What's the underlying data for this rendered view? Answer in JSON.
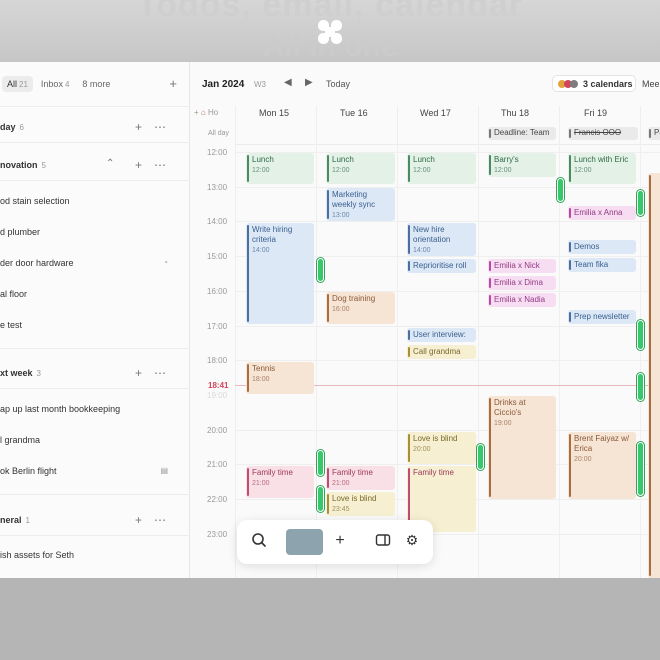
{
  "backdrop": {
    "headline_1": "Todos, email, calendar",
    "headline_2": "All in one"
  },
  "sidebar": {
    "tabs": [
      {
        "label": "All",
        "count": "21",
        "active": true
      },
      {
        "label": "Inbox",
        "count": "4",
        "active": false
      },
      {
        "label": "8 more",
        "count": "",
        "active": false
      }
    ],
    "sections": [
      {
        "title": "day",
        "count": "6"
      },
      {
        "title": "novation",
        "count": "5"
      },
      {
        "title": "xt week",
        "count": "3"
      },
      {
        "title": "neral",
        "count": "1"
      }
    ],
    "items": [
      {
        "label": "od stain selection",
        "icon": ""
      },
      {
        "label": "d plumber",
        "icon": ""
      },
      {
        "label": "der door hardware",
        "icon": "clock-icon"
      },
      {
        "label": "al floor",
        "icon": ""
      },
      {
        "label": "e test",
        "icon": ""
      },
      {
        "label": "ap up last month bookkeeping",
        "icon": ""
      },
      {
        "label": "l grandma",
        "icon": ""
      },
      {
        "label": "ok Berlin flight",
        "icon": "document-icon"
      },
      {
        "label": "ish assets for Seth",
        "icon": ""
      }
    ]
  },
  "calendar": {
    "month": "Jan 2024",
    "week": "W3",
    "today_label": "Today",
    "calendars_label": "3 calendars",
    "meet_label": "Mee",
    "timezone_label": "Ho",
    "allday_label": "All day",
    "days": [
      "Mon 15",
      "Tue 16",
      "Wed 17",
      "Thu 18",
      "Fri 19"
    ],
    "hours": [
      "12:00",
      "13:00",
      "14:00",
      "15:00",
      "16:00",
      "17:00",
      "18:00",
      "19:00",
      "20:00",
      "21:00",
      "22:00",
      "23:00"
    ],
    "now_label": "18:41",
    "allday_events": [
      {
        "title": "Deadline: Team",
        "strike": false
      },
      {
        "title": "Francis OOO",
        "strike": true
      },
      {
        "title": "Pa",
        "strike": false
      }
    ],
    "events": [
      {
        "title": "Lunch",
        "time": "12:00",
        "color": "green"
      },
      {
        "title": "Lunch",
        "time": "12:00",
        "color": "green"
      },
      {
        "title": "Lunch",
        "time": "12:00",
        "color": "green"
      },
      {
        "title": "Barry's",
        "time": "12:00",
        "color": "green"
      },
      {
        "title": "Lunch with Eric",
        "time": "12:00",
        "color": "green"
      },
      {
        "title": "Marketing weekly sync",
        "time": "13:00",
        "color": "blue"
      },
      {
        "title": "Emilia x Anna",
        "time": "",
        "color": "magenta"
      },
      {
        "title": "Write hiring criteria",
        "time": "14:00",
        "color": "blue"
      },
      {
        "title": "New hire orientation",
        "time": "14:00",
        "color": "blue"
      },
      {
        "title": "Demos",
        "time": "",
        "color": "blue"
      },
      {
        "title": "Reprioritise roll",
        "time": "",
        "color": "blue"
      },
      {
        "title": "Emilia x Nick",
        "time": "",
        "color": "magenta"
      },
      {
        "title": "Team fika",
        "time": "",
        "color": "blue"
      },
      {
        "title": "Emilia x Dima",
        "time": "",
        "color": "magenta"
      },
      {
        "title": "Dog training",
        "time": "16:00",
        "color": "orange"
      },
      {
        "title": "Emilia x Nadia",
        "time": "",
        "color": "magenta"
      },
      {
        "title": "Prep newsletter",
        "time": "",
        "color": "blue"
      },
      {
        "title": "User interview:",
        "time": "",
        "color": "blue"
      },
      {
        "title": "Call grandma",
        "time": "",
        "color": "yellow"
      },
      {
        "title": "Tennis",
        "time": "18:00",
        "color": "orange"
      },
      {
        "title": "Drinks at Ciccio's",
        "time": "19:00",
        "color": "orange"
      },
      {
        "title": "Love is blind",
        "time": "20:00",
        "color": "yellow"
      },
      {
        "title": "Brent Faiyaz w/ Erica",
        "time": "20:00",
        "color": "orange"
      },
      {
        "title": "Family time",
        "time": "",
        "color": "pink"
      },
      {
        "title": "Family time",
        "time": "21:00",
        "color": "pink"
      },
      {
        "title": "Family time",
        "time": "21:00",
        "color": "pink"
      },
      {
        "title": "Love is blind",
        "time": "23:45",
        "color": "yellow"
      }
    ]
  },
  "toolbar": {
    "icons": [
      "search-icon",
      "color-swatch",
      "plus-icon",
      "sidebar-toggle-icon",
      "gear-icon"
    ],
    "swatch_color": "#8da3ae"
  },
  "colors": {
    "accent_green": "#37c86a",
    "now_red": "#d0455b",
    "calendar_dots": [
      "#e2a33a",
      "#d0455b",
      "#7d7d7d"
    ]
  }
}
